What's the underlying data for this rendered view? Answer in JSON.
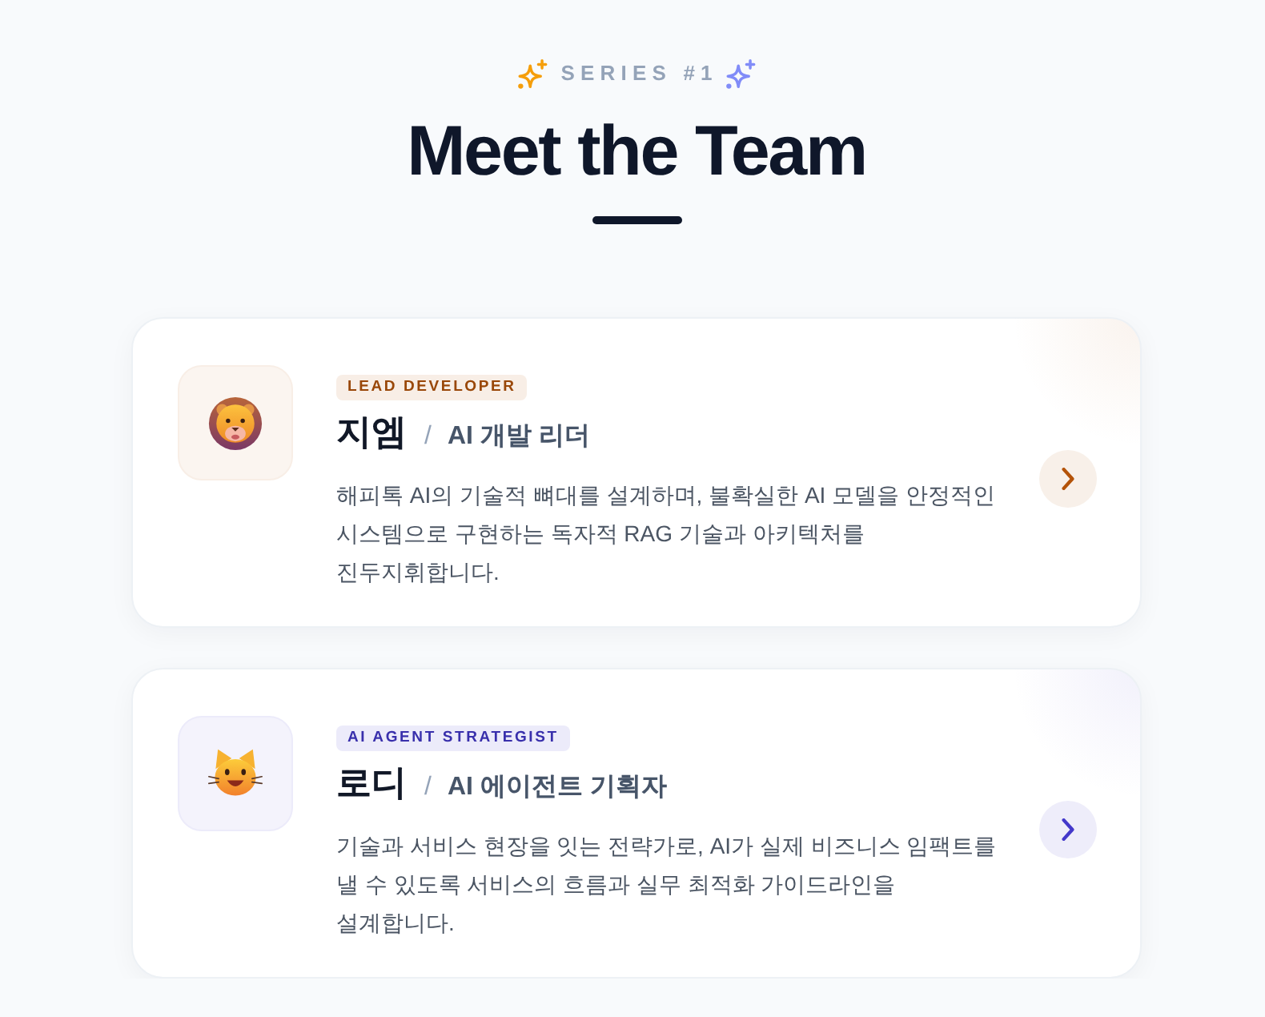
{
  "header": {
    "eyebrow": "SERIES #1",
    "title": "Meet the Team"
  },
  "members": [
    {
      "badge": "LEAD DEVELOPER",
      "name": "지엠",
      "separator": "/",
      "role": "AI 개발 리더",
      "description": "해피톡 AI의 기술적 뼈대를 설계하며, 불확실한 AI 모델을 안정적인 시스템으로 구현하는 독자적 RAG 기술과 아키텍처를 진두지휘합니다.",
      "color": "#b45309"
    },
    {
      "badge": "AI AGENT STRATEGIST",
      "name": "로디",
      "separator": "/",
      "role": "AI 에이전트 기획자",
      "description": "기술과 서비스 현장을 잇는 전략가로, AI가 실제 비즈니스 임팩트를 낼 수 있도록 서비스의 흐름과 실무 최적화 가이드라인을 설계합니다.",
      "color": "#4338ca"
    }
  ]
}
